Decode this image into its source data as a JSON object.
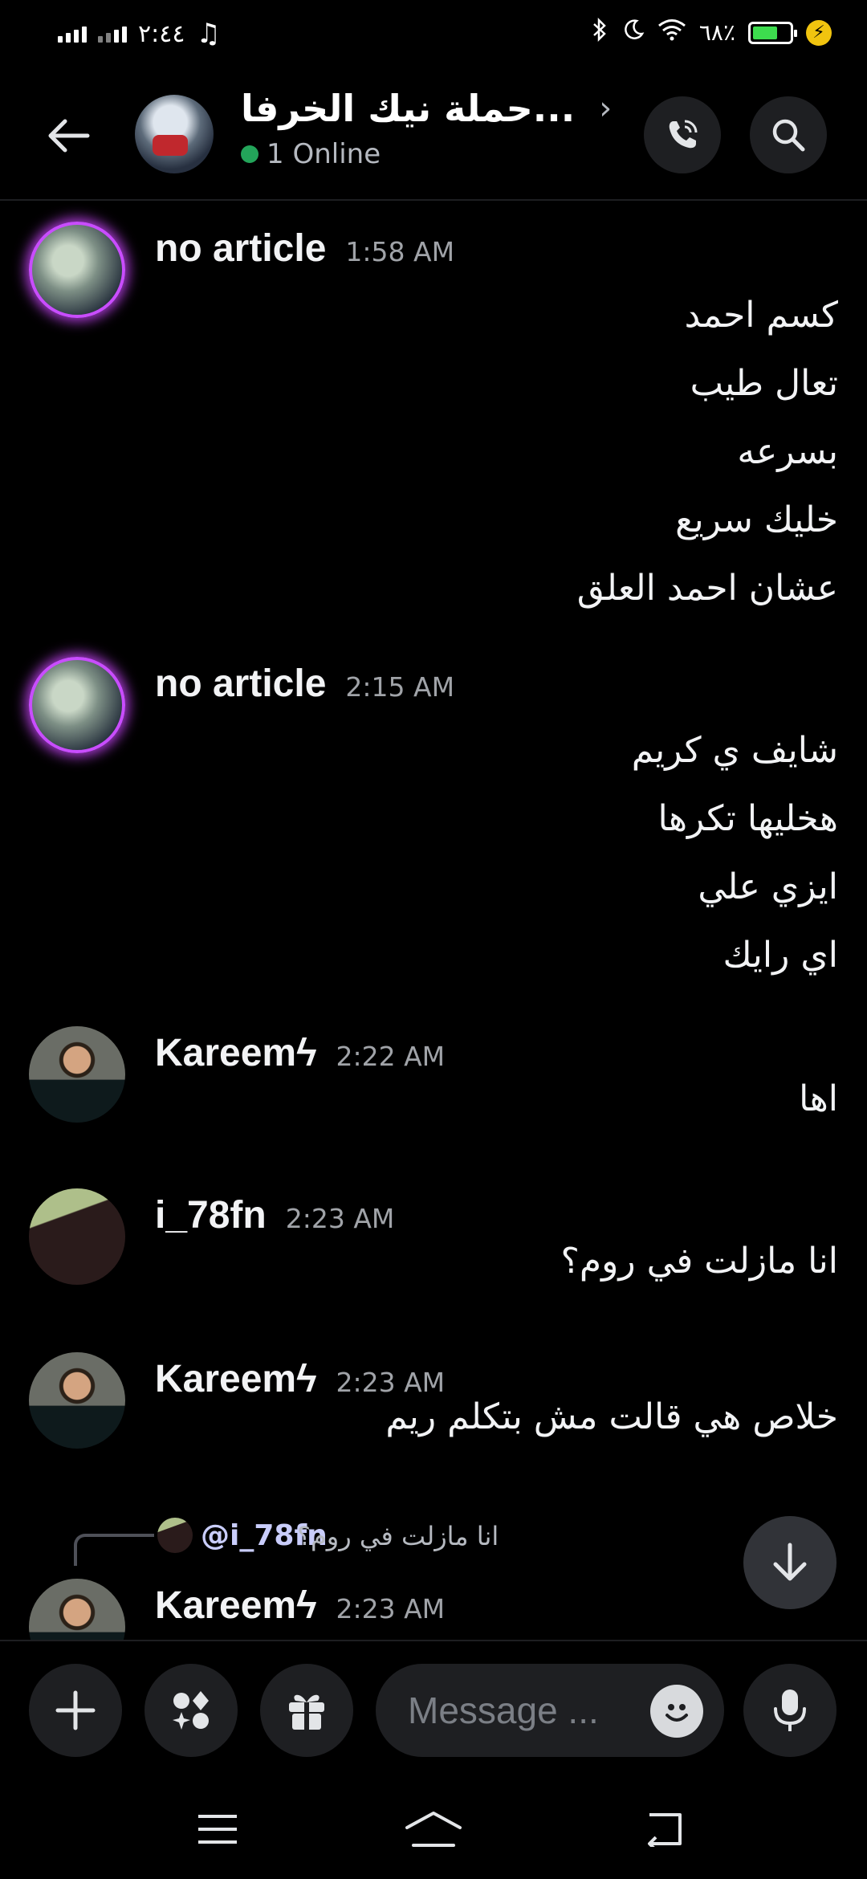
{
  "status_bar": {
    "time": "٢:٤٤",
    "battery_percent": "٦٨٪",
    "battery_level": 0.68,
    "icons": [
      "signal-icon",
      "signal-icon",
      "music-note-icon",
      "bluetooth-icon",
      "moon-icon",
      "wifi-icon",
      "battery-icon",
      "charging-bolt-icon"
    ]
  },
  "header": {
    "title": "حملة نيك الخرفا...",
    "online_text": "1 Online",
    "icons": [
      "back-arrow-icon",
      "chevron-right-icon",
      "phone-call-icon",
      "search-icon"
    ]
  },
  "colors": {
    "background": "#000000",
    "online": "#23a55a",
    "avatar_glow": "#c94dff",
    "composer_bg": "#1e1f22"
  },
  "messages": [
    {
      "username": "no article",
      "timestamp": "1:58 AM",
      "lines": [
        "كسم احمد",
        "تعال طيب",
        "بسرعه",
        "خليك سريع",
        "عشان احمد العلق"
      ]
    },
    {
      "username": "no article",
      "timestamp": "2:15 AM",
      "lines": [
        "شايف ي كريم",
        "هخليها تكرها",
        "ايزي علي",
        "اي رايك"
      ]
    },
    {
      "username": "Kareemϟ",
      "timestamp": "2:22 AM",
      "lines": [
        "اها"
      ]
    },
    {
      "username": "i_78fn",
      "timestamp": "2:23 AM",
      "lines": [
        "انا مازلت في روم؟"
      ]
    },
    {
      "username": "Kareemϟ",
      "timestamp": "2:23 AM",
      "lines": [
        "خلاص هي قالت مش بتكلم ريم"
      ]
    },
    {
      "username": "Kareemϟ",
      "timestamp": "2:23 AM",
      "lines": []
    }
  ],
  "reply": {
    "user": "@i_78fn",
    "text": "انا مازلت في روم؟"
  },
  "composer": {
    "placeholder": "Message ...",
    "icons": [
      "plus-icon",
      "apps-icon",
      "gift-icon",
      "emoji-icon",
      "microphone-icon"
    ]
  },
  "nav_bar": {
    "icons": [
      "menu-icon",
      "home-icon",
      "back-icon"
    ]
  }
}
